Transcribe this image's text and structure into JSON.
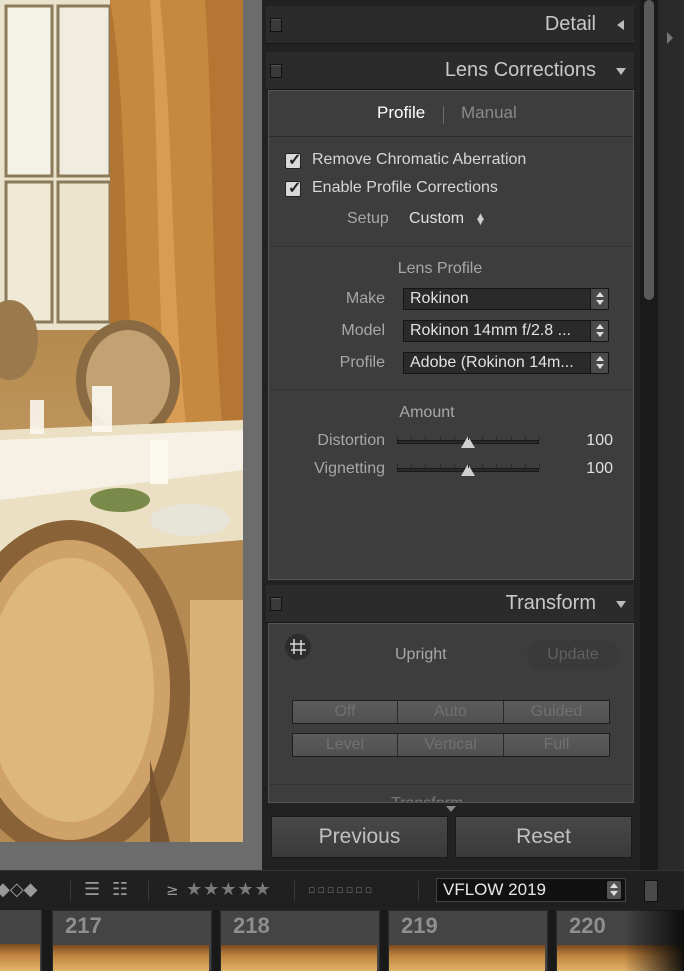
{
  "panels": {
    "detail": {
      "title": "Detail"
    },
    "lens_corrections": {
      "title": "Lens Corrections",
      "tabs": {
        "profile": "Profile",
        "manual": "Manual"
      },
      "checks": {
        "chromatic": "Remove Chromatic Aberration",
        "profile": "Enable Profile Corrections"
      },
      "setup": {
        "label": "Setup",
        "value": "Custom"
      },
      "lens_profile": {
        "title": "Lens Profile",
        "make_label": "Make",
        "make_value": "Rokinon",
        "model_label": "Model",
        "model_value": "Rokinon 14mm f/2.8 ...",
        "profile_label": "Profile",
        "profile_value": "Adobe (Rokinon 14m..."
      },
      "amount": {
        "title": "Amount",
        "distortion_label": "Distortion",
        "distortion_value": "100",
        "distortion_fraction": 0.5,
        "vignetting_label": "Vignetting",
        "vignetting_value": "100",
        "vignetting_fraction": 0.5
      }
    },
    "transform": {
      "title": "Transform",
      "upright_label": "Upright",
      "update_label": "Update",
      "buttons_row1": [
        "Off",
        "Auto",
        "Guided"
      ],
      "buttons_row2": [
        "Level",
        "Vertical",
        "Full"
      ],
      "sub_heading_partial": "Transform"
    }
  },
  "footer": {
    "previous": "Previous",
    "reset": "Reset"
  },
  "toolbar": {
    "rating_op": "≥",
    "stars": "★★★★★",
    "color_squares": "▫▫▫▫▫▫▫",
    "collection": "VFLOW 2019"
  },
  "filmstrip": {
    "frames": [
      "217",
      "218",
      "219",
      "220"
    ]
  },
  "colors": {
    "panel_bg": "#3d3d3d",
    "header_bg": "#2b2b2b",
    "text_active": "#ffffff"
  }
}
